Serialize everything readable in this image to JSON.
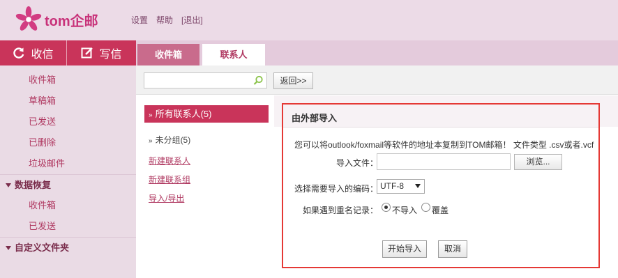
{
  "brand": {
    "logo_text": "tom企邮",
    "accent": "#c9345a",
    "panel_border": "#e53935"
  },
  "top_links": [
    "设置",
    "帮助",
    "[退出]"
  ],
  "sidebar": {
    "receive_label": "收信",
    "write_label": "写信",
    "folders": [
      "收件箱",
      "草稿箱",
      "已发送",
      "已删除",
      "垃圾邮件"
    ],
    "recovery": {
      "title": "数据恢复",
      "items": [
        "收件箱",
        "已发送"
      ]
    },
    "custom_folder_title": "自定义文件夹"
  },
  "tabs": {
    "inbox": "收件箱",
    "contacts": "联系人"
  },
  "toolbar": {
    "search_value": "",
    "back_label": "返回>>"
  },
  "groups": {
    "all": "所有联系人(5)",
    "ungrouped": "未分组(5)",
    "links": [
      "新建联系人",
      "新建联系组",
      "导入/导出"
    ]
  },
  "import_panel": {
    "title": "由外部导入",
    "description": "您可以将outlook/foxmail等软件的地址本复制到TOM邮箱！ 文件类型 .csv或者.vcf",
    "file_label": "导入文件：",
    "file_value": "",
    "browse_label": "浏览...",
    "encoding_label": "选择需要导入的编码：",
    "encoding_value": "UTF-8",
    "duplicate_label": "如果遇到重名记录：",
    "option_skip": "不导入",
    "option_overwrite": "覆盖",
    "selected_option": "skip",
    "start_label": "开始导入",
    "cancel_label": "取消"
  }
}
